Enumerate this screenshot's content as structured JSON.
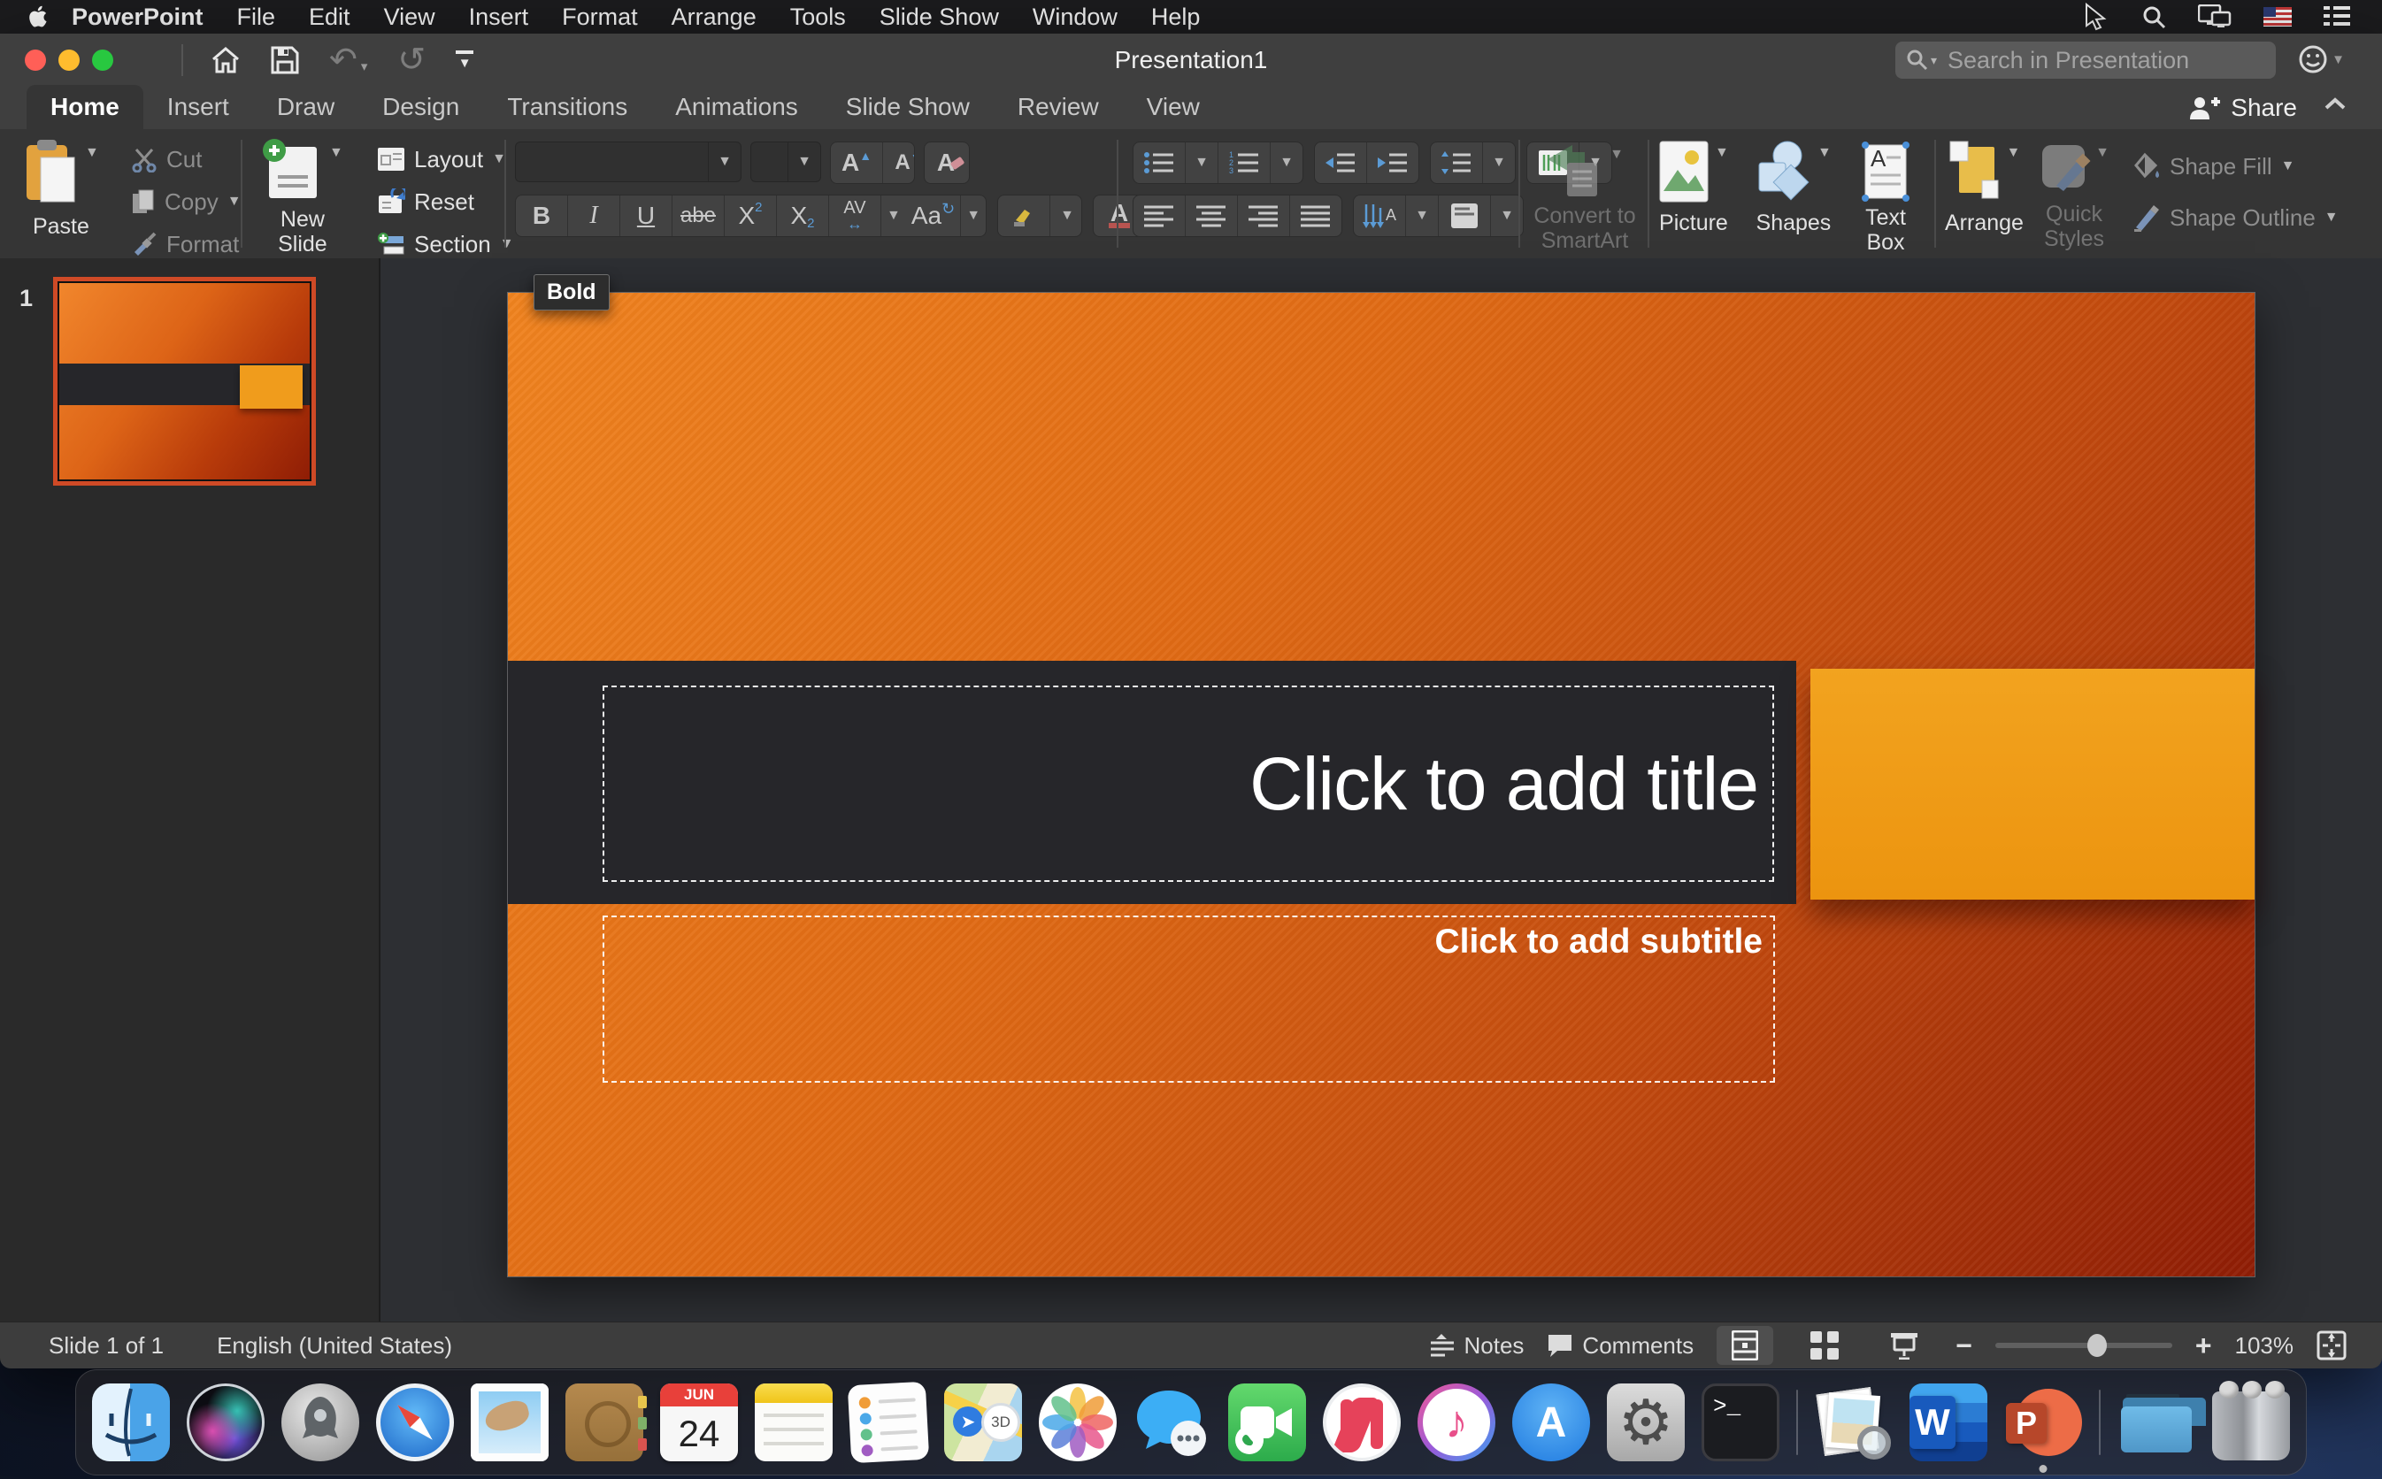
{
  "menu_bar": {
    "app_name": "PowerPoint",
    "items": [
      "File",
      "Edit",
      "View",
      "Insert",
      "Format",
      "Arrange",
      "Tools",
      "Slide Show",
      "Window",
      "Help"
    ]
  },
  "window": {
    "title": "Presentation1",
    "search_placeholder": "Search in Presentation"
  },
  "tabs": {
    "items": [
      "Home",
      "Insert",
      "Draw",
      "Design",
      "Transitions",
      "Animations",
      "Slide Show",
      "Review",
      "View"
    ],
    "share": "Share"
  },
  "ribbon": {
    "clipboard": {
      "paste": "Paste",
      "cut": "Cut",
      "copy": "Copy",
      "format": "Format"
    },
    "slides": {
      "new_slide": "New Slide",
      "layout": "Layout",
      "reset": "Reset",
      "section": "Section"
    },
    "font": {
      "bold": "B",
      "italic": "I",
      "underline": "U",
      "strike": "abe",
      "sup": "X",
      "sup_n": "2",
      "sub": "X",
      "sub_n": "2",
      "spacing": "AV",
      "case_a": "Aa",
      "grow": "A",
      "shrink": "A",
      "clear": "A",
      "color": "A"
    },
    "smartart": "Convert to SmartArt",
    "insert": {
      "picture": "Picture",
      "shapes": "Shapes",
      "text_box": "Text Box"
    },
    "arrange": {
      "arrange": "Arrange",
      "quick_styles": "Quick Styles"
    },
    "shape": {
      "fill": "Shape Fill",
      "outline": "Shape Outline"
    }
  },
  "tooltip": "Bold",
  "slides_panel": {
    "slide_number": "1"
  },
  "slide": {
    "title_placeholder": "Click to add title",
    "subtitle_placeholder": "Click to add subtitle"
  },
  "status_bar": {
    "slide_info": "Slide 1 of 1",
    "language": "English (United States)",
    "notes": "Notes",
    "comments": "Comments",
    "zoom_level": "103%"
  },
  "dock": {
    "calendar_month": "JUN",
    "calendar_day": "24",
    "maps_badge": "3D",
    "music_note": "♪",
    "appstore_letter": "A",
    "gear_glyph": "⚙",
    "terminal_prompt": ">_",
    "word_letter": "W",
    "powerpoint_letter": "P",
    "apps": [
      "finder",
      "siri",
      "launchpad",
      "safari",
      "mail",
      "contacts",
      "calendar",
      "notes",
      "reminders",
      "maps",
      "photos",
      "messages",
      "facetime",
      "news",
      "music",
      "app-store",
      "system-preferences",
      "terminal",
      "preview",
      "word",
      "powerpoint",
      "downloads-folder",
      "trash"
    ]
  },
  "colors": {
    "selection_border": "#cf4a26",
    "slide_band": "#26262a",
    "slide_orange_rect": "#f09d1d",
    "accent_blue": "#5b9bd5"
  }
}
